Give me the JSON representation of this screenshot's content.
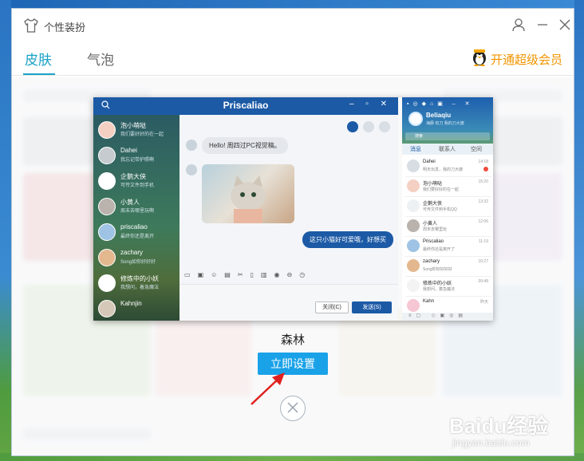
{
  "window": {
    "title": "个性装扮"
  },
  "tabs": [
    {
      "label": "皮肤",
      "active": true
    },
    {
      "label": "气泡",
      "active": false
    }
  ],
  "vip_label": "开通超级会员",
  "preview": {
    "chat_title": "Priscaliao",
    "contacts": [
      {
        "name": "泡小萌哒",
        "msg": "我们要好好的在一起"
      },
      {
        "name": "Dahei",
        "msg": "我忘记带护照啊"
      },
      {
        "name": "企鹅大侠",
        "msg": "可传文件到手机"
      },
      {
        "name": "小黄人",
        "msg": "周末去哪里玩啊"
      },
      {
        "name": "priscaliao",
        "msg": "最终你还是离开"
      },
      {
        "name": "zachary",
        "msg": "Song如你好好好"
      },
      {
        "name": "修炼中的小妖",
        "msg": "我想问，着急魔法"
      },
      {
        "name": "Kahnjin",
        "msg": ""
      }
    ],
    "msg_incoming": "Hello! 周四过PC视觉稿。",
    "msg_outgoing": "这只小猫好可爱哦，好想买",
    "close_btn": "关闭(C)",
    "send_btn": "发送(S)",
    "panel": {
      "nickname": "Beliaqiu",
      "signature": "海豚 有刀 我的刀大嫂",
      "search_placeholder": "搜索",
      "tabs": [
        "消息",
        "联系人",
        "空间"
      ],
      "items": [
        {
          "name": "Dahei",
          "msg": "明天出发，我的刀大嫂",
          "time": "14:18"
        },
        {
          "name": "泡小萌哒",
          "msg": "我们要好好的在一起",
          "time": "15:20"
        },
        {
          "name": "企鹅大侠",
          "msg": "可传文件到手机QQ",
          "time": "13:32"
        },
        {
          "name": "小黄人",
          "msg": "周末去哪里玩",
          "time": "12:06"
        },
        {
          "name": "Priscaliao",
          "msg": "最终你还是离开了",
          "time": "11:19"
        },
        {
          "name": "zachary",
          "msg": "Song你好好好好",
          "time": "10:27"
        },
        {
          "name": "修炼中的小妖",
          "msg": "我想问，着急魔法",
          "time": "09:48"
        },
        {
          "name": "Kahn",
          "msg": "",
          "time": "昨天"
        }
      ]
    }
  },
  "skin_name": "森林",
  "apply_btn": "立即设置",
  "watermark": {
    "logo": "Baidu经验",
    "url": "jingyan.baidu.com"
  },
  "colors": {
    "accent": "#1aa2c8",
    "button": "#1aa2e8",
    "vip": "#f29400",
    "chat_header": "#1c5aa6"
  }
}
